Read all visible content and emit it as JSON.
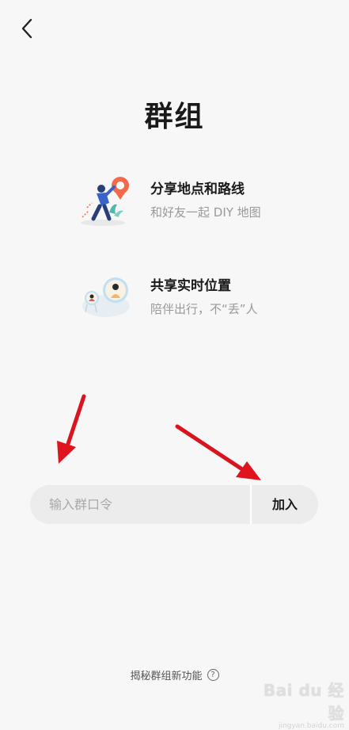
{
  "header": {
    "title": "群组"
  },
  "features": [
    {
      "title": "分享地点和路线",
      "subtitle": "和好友一起 DIY 地图"
    },
    {
      "title": "共享实时位置",
      "subtitle": "陪伴出行，不“丢”人"
    }
  ],
  "join": {
    "placeholder": "输入群口令",
    "value": "",
    "button_label": "加入"
  },
  "footer": {
    "link_label": "揭秘群组新功能"
  },
  "watermark": {
    "logo": "Bai du 经验",
    "url": "jingyan.baidu.com"
  },
  "colors": {
    "background": "#f7f7f7",
    "accent_orange": "#f26a4b",
    "arrow_red": "#e0141e",
    "input_bg": "#ececec"
  }
}
